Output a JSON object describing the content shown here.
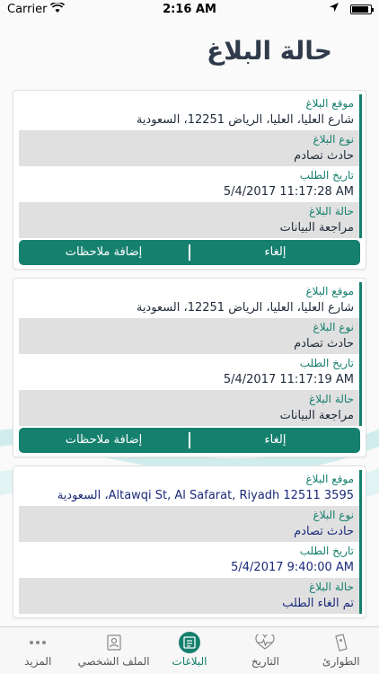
{
  "status_bar": {
    "carrier": "Carrier",
    "time": "2:16 AM",
    "battery_level": 0.9
  },
  "page": {
    "title": "حالة البلاغ"
  },
  "labels": {
    "location": "موقع البلاغ",
    "type": "نوع البلاغ",
    "date": "تاريخ الطلب",
    "status": "حالة البلاغ"
  },
  "reports": [
    {
      "location": "شارع العليا، العليا، الرياض 12251، السعودية",
      "type": "حادث تصادم",
      "date": "5/4/2017 11:17:28 AM",
      "status": "مراجعة البيانات",
      "cancel_label": "إلغاء",
      "notes_label": "إضافة ملاحظات"
    },
    {
      "location": "شارع العليا، العليا، الرياض 12251، السعودية",
      "type": "حادث تصادم",
      "date": "5/4/2017 11:17:19 AM",
      "status": "مراجعة البيانات",
      "cancel_label": "إلغاء",
      "notes_label": "إضافة ملاحظات"
    },
    {
      "location": "3595 Altawqi St, Al Safarat, Riyadh 12511، السعودية",
      "type": "حادث تصادم",
      "date": "5/4/2017 9:40:00 AM",
      "status": "تم الغاء الطلب"
    }
  ],
  "tabbar": {
    "items": [
      {
        "label": "المزيد",
        "icon": "more-icon"
      },
      {
        "label": "الملف الشخصي",
        "icon": "profile-icon"
      },
      {
        "label": "البلاغات",
        "icon": "reports-icon"
      },
      {
        "label": "التاريخ",
        "icon": "history-icon"
      },
      {
        "label": "الطوارئ",
        "icon": "emergency-icon"
      }
    ],
    "active": "البلاغات"
  },
  "colors": {
    "accent": "#16806f",
    "row_gray": "#e0e0e0",
    "title": "#2f3a4a"
  }
}
